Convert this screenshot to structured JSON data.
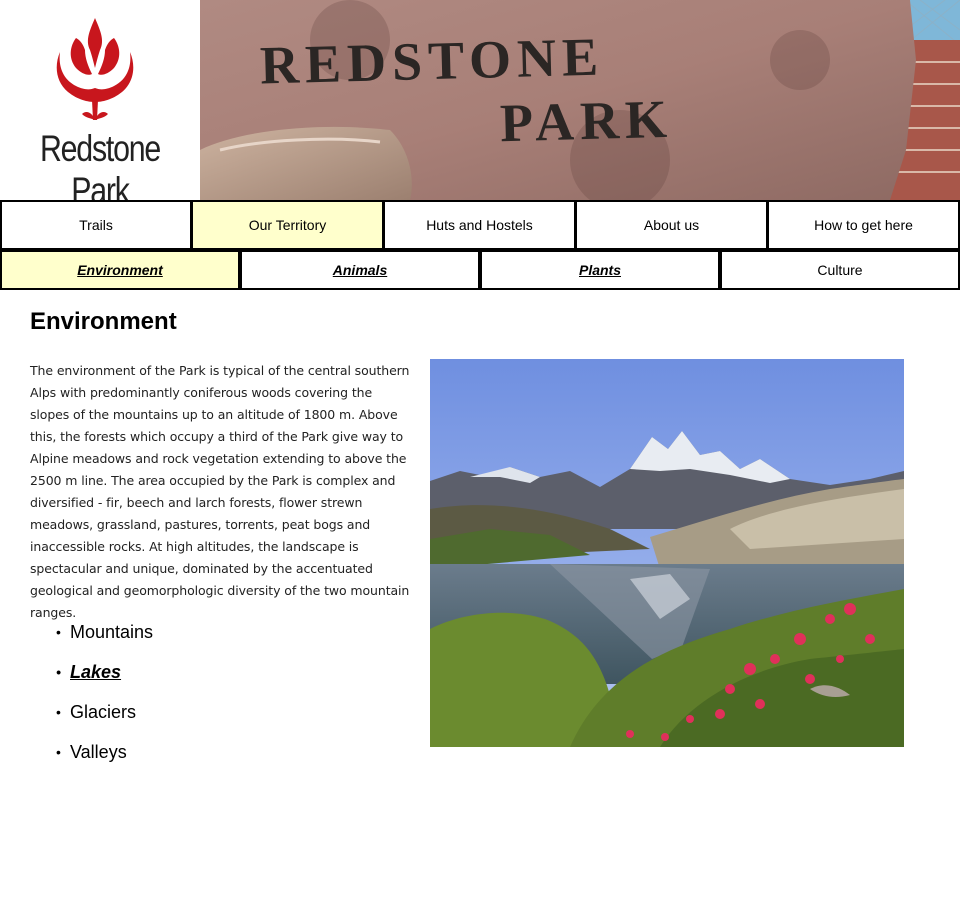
{
  "header": {
    "logo_text": "Redstone Park",
    "banner_line1": "REDSTONE",
    "banner_line2": "PARK"
  },
  "nav_primary": [
    {
      "label": "Trails",
      "active": false
    },
    {
      "label": "Our Territory",
      "active": true
    },
    {
      "label": "Huts and Hostels",
      "active": false
    },
    {
      "label": "About us",
      "active": false
    },
    {
      "label": "How to get here",
      "active": false
    }
  ],
  "nav_secondary": [
    {
      "label": "Environment",
      "active": true,
      "link": true
    },
    {
      "label": "Animals",
      "active": false,
      "link": true
    },
    {
      "label": "Plants",
      "active": false,
      "link": true
    },
    {
      "label": "Culture",
      "active": false,
      "link": false
    }
  ],
  "main": {
    "title": "Environment",
    "intro": "The environment of the Park is typical of the central southern Alps with predominantly coniferous woods covering the slopes of the mountains up to an altitude of 1800 m.  Above this, the forests which occupy a third of the Park give way to Alpine meadows and rock vegetation extending to above the 2500 m line.  The area occupied by the Park is complex and diversified - fir, beech and larch forests, flower strewn meadows, grassland, pastures, torrents, peat bogs and inaccessible rocks.  At high altitudes, the landscape is spectacular and unique, dominated by the accentuated geological and geomorphologic diversity of the two mountain ranges.",
    "topics": [
      {
        "label": "Mountains",
        "link": false
      },
      {
        "label": "Lakes",
        "link": true
      },
      {
        "label": "Glaciers",
        "link": false
      },
      {
        "label": "Valleys",
        "link": false
      }
    ]
  },
  "colors": {
    "active_tab": "#ffffcc",
    "logo_red": "#c8161d",
    "border": "#000000"
  }
}
